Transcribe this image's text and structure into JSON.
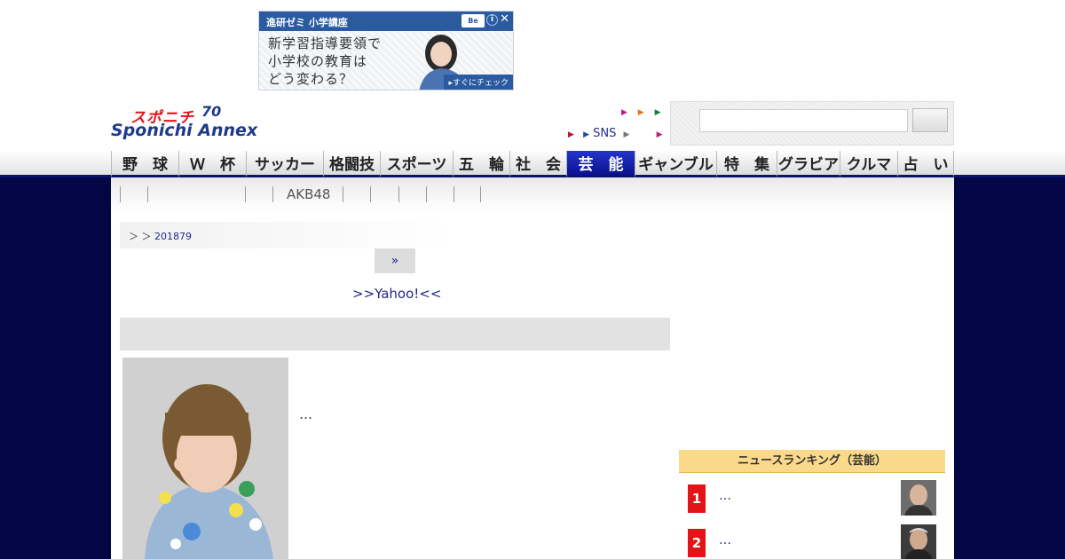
{
  "ad": {
    "brand": "進研ゼミ 小学講座",
    "headline_line1": "新学習指導要領で",
    "headline_line2": "小学校の教育は",
    "headline_line3": "どう変わる？",
    "cta": "▸すぐにチェック",
    "info_icon": "info-icon",
    "close_icon": "close-icon"
  },
  "logo": {
    "top": "スポニチ",
    "bottom": "Sponichi Annex",
    "anniversary": "70"
  },
  "header": {
    "sns_label": "SNS",
    "arrow_colors": [
      "#c4177c",
      "#e8741a",
      "#167a3c",
      "#c8102e",
      "#1a4fa0",
      "#777777",
      "#c4177c"
    ]
  },
  "search": {
    "placeholder": "",
    "button_label": ""
  },
  "nav": {
    "items": [
      {
        "label": "野　球"
      },
      {
        "label": "Ｗ　杯"
      },
      {
        "label": "サッカー"
      },
      {
        "label": "格闘技"
      },
      {
        "label": "スポーツ"
      },
      {
        "label": "五　輪"
      },
      {
        "label": "社　会"
      },
      {
        "label": "芸　能"
      },
      {
        "label": "ギャンブル"
      },
      {
        "label": "特　集"
      },
      {
        "label": "グラビア"
      },
      {
        "label": "クルマ"
      },
      {
        "label": "占　い"
      }
    ],
    "active_index": 7
  },
  "subnav": {
    "akb": "AKB48"
  },
  "breadcrumb": {
    "prefix": "＞ ＞",
    "link": "201879"
  },
  "article": {
    "more_button": "»",
    "yahoo_link": ">>Yahoo!<<",
    "snippet": "…"
  },
  "ranking": {
    "title": "ニュースランキング（芸能）",
    "items": [
      {
        "rank": "1",
        "text": "…"
      },
      {
        "rank": "2",
        "text": "…"
      }
    ]
  },
  "colors": {
    "navy": "#030645",
    "nav_active": "#0a128f",
    "link": "#22298a",
    "rank_badge": "#e21418",
    "ranking_header": "#fbd98a"
  }
}
